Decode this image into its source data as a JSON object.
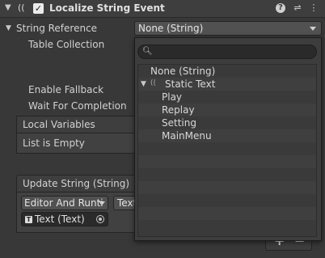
{
  "header": {
    "title": "Localize String Event",
    "enabled": true,
    "help_icon": "help-icon",
    "settings_icon": "sliders-icon",
    "menu_icon": "kebab-menu-icon"
  },
  "fields": {
    "string_reference_label": "String Reference",
    "string_reference_value": "None (String)",
    "table_collection_label": "Table Collection",
    "enable_fallback_label": "Enable Fallback",
    "wait_for_completion_label": "Wait For Completion"
  },
  "local_variables": {
    "title": "Local Variables",
    "empty_text": "List is Empty"
  },
  "update_string": {
    "title": "Update String (String)",
    "runtime_mode": "Editor And Runti",
    "function": "Text.text",
    "target": "Text (Text)",
    "add_label": "+",
    "remove_label": "−"
  },
  "popup": {
    "search_placeholder": "",
    "items": {
      "none": "None (String)",
      "group": "Static Text",
      "play": "Play",
      "replay": "Replay",
      "setting": "Setting",
      "mainmenu": "MainMenu"
    }
  },
  "colors": {
    "background": "#383838",
    "field": "#515151",
    "popup": "#3d3d3d"
  }
}
